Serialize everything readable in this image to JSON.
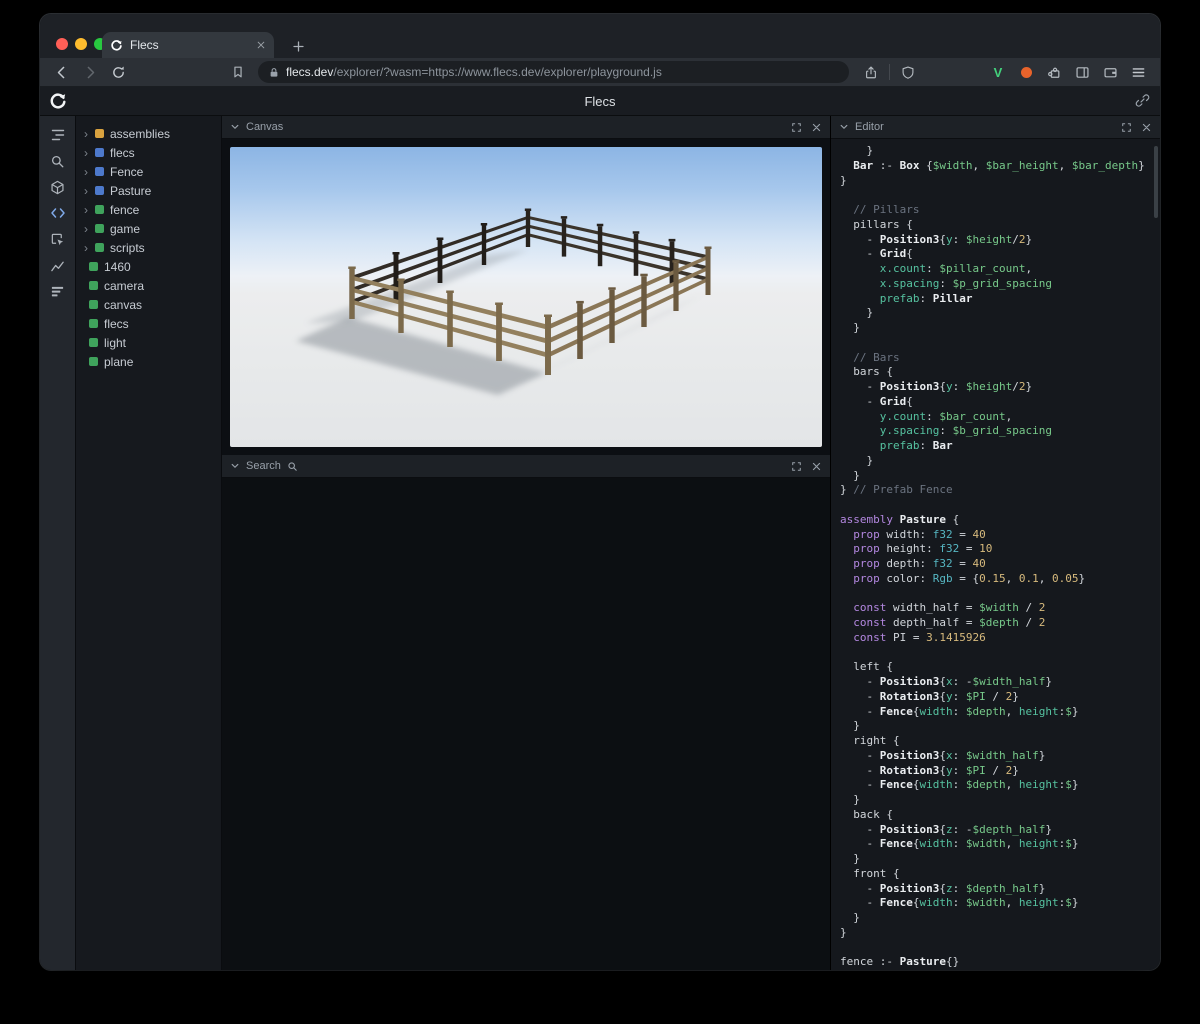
{
  "window": {
    "tab_title": "Flecs",
    "url_domain": "flecs.dev",
    "url_path": "/explorer/?wasm=https://www.flecs.dev/explorer/playground.js",
    "extension_v": "V"
  },
  "app": {
    "title": "Flecs"
  },
  "panels": {
    "canvas_title": "Canvas",
    "search_title": "Search",
    "editor_title": "Editor"
  },
  "activity_bar": {
    "icons": [
      "entity-tree-icon",
      "search-icon",
      "canvas-cube-icon",
      "code-icon",
      "inspect-icon",
      "stats-chart-icon",
      "queries-rows-icon"
    ]
  },
  "tree": {
    "items": [
      {
        "label": "assemblies",
        "color": "#d9a23f",
        "expandable": true
      },
      {
        "label": "flecs",
        "color": "#4d79cc",
        "expandable": true
      },
      {
        "label": "Fence",
        "color": "#4d79cc",
        "expandable": true
      },
      {
        "label": "Pasture",
        "color": "#4d79cc",
        "expandable": true
      },
      {
        "label": "fence",
        "color": "#3fa35c",
        "expandable": true
      },
      {
        "label": "game",
        "color": "#3fa35c",
        "expandable": true
      },
      {
        "label": "scripts",
        "color": "#3fa35c",
        "expandable": true
      },
      {
        "label": "1460",
        "color": "#3fa35c",
        "expandable": false
      },
      {
        "label": "camera",
        "color": "#3fa35c",
        "expandable": false
      },
      {
        "label": "canvas",
        "color": "#3fa35c",
        "expandable": false
      },
      {
        "label": "flecs",
        "color": "#3fa35c",
        "expandable": false
      },
      {
        "label": "light",
        "color": "#3fa35c",
        "expandable": false
      },
      {
        "label": "plane",
        "color": "#3fa35c",
        "expandable": false
      }
    ]
  },
  "editor": {
    "lines": [
      [
        [
          "p",
          "    }"
        ]
      ],
      [
        [
          "p",
          "  "
        ],
        [
          "b",
          "Bar"
        ],
        [
          "p",
          " :- "
        ],
        [
          "b",
          "Box"
        ],
        [
          "p",
          " {"
        ],
        [
          "v",
          "$width"
        ],
        [
          "p",
          ", "
        ],
        [
          "v",
          "$bar_height"
        ],
        [
          "p",
          ", "
        ],
        [
          "v",
          "$bar_depth"
        ],
        [
          "p",
          "}"
        ]
      ],
      [
        [
          "p",
          "}"
        ]
      ],
      [],
      [
        [
          "p",
          "  "
        ],
        [
          "c",
          "// Pillars"
        ]
      ],
      [
        [
          "p",
          "  pillars {"
        ]
      ],
      [
        [
          "p",
          "    - "
        ],
        [
          "b",
          "Position3"
        ],
        [
          "p",
          "{"
        ],
        [
          "m",
          "y"
        ],
        [
          "p",
          ": "
        ],
        [
          "v",
          "$height"
        ],
        [
          "p",
          "/"
        ],
        [
          "n",
          "2"
        ],
        [
          "p",
          "}"
        ]
      ],
      [
        [
          "p",
          "    - "
        ],
        [
          "b",
          "Grid"
        ],
        [
          "p",
          "{"
        ]
      ],
      [
        [
          "p",
          "      "
        ],
        [
          "m",
          "x.count"
        ],
        [
          "p",
          ": "
        ],
        [
          "v",
          "$pillar_count"
        ],
        [
          "p",
          ","
        ]
      ],
      [
        [
          "p",
          "      "
        ],
        [
          "m",
          "x.spacing"
        ],
        [
          "p",
          ": "
        ],
        [
          "v",
          "$p_grid_spacing"
        ]
      ],
      [
        [
          "p",
          "      "
        ],
        [
          "m",
          "prefab"
        ],
        [
          "p",
          ": "
        ],
        [
          "b",
          "Pillar"
        ]
      ],
      [
        [
          "p",
          "    }"
        ]
      ],
      [
        [
          "p",
          "  }"
        ]
      ],
      [],
      [
        [
          "p",
          "  "
        ],
        [
          "c",
          "// Bars"
        ]
      ],
      [
        [
          "p",
          "  bars {"
        ]
      ],
      [
        [
          "p",
          "    - "
        ],
        [
          "b",
          "Position3"
        ],
        [
          "p",
          "{"
        ],
        [
          "m",
          "y"
        ],
        [
          "p",
          ": "
        ],
        [
          "v",
          "$height"
        ],
        [
          "p",
          "/"
        ],
        [
          "n",
          "2"
        ],
        [
          "p",
          "}"
        ]
      ],
      [
        [
          "p",
          "    - "
        ],
        [
          "b",
          "Grid"
        ],
        [
          "p",
          "{"
        ]
      ],
      [
        [
          "p",
          "      "
        ],
        [
          "m",
          "y.count"
        ],
        [
          "p",
          ": "
        ],
        [
          "v",
          "$bar_count"
        ],
        [
          "p",
          ","
        ]
      ],
      [
        [
          "p",
          "      "
        ],
        [
          "m",
          "y.spacing"
        ],
        [
          "p",
          ": "
        ],
        [
          "v",
          "$b_grid_spacing"
        ]
      ],
      [
        [
          "p",
          "      "
        ],
        [
          "m",
          "prefab"
        ],
        [
          "p",
          ": "
        ],
        [
          "b",
          "Bar"
        ]
      ],
      [
        [
          "p",
          "    }"
        ]
      ],
      [
        [
          "p",
          "  }"
        ]
      ],
      [
        [
          "p",
          "} "
        ],
        [
          "c",
          "// Prefab Fence"
        ]
      ],
      [],
      [
        [
          "k",
          "assembly"
        ],
        [
          "p",
          " "
        ],
        [
          "b",
          "Pasture"
        ],
        [
          "p",
          " {"
        ]
      ],
      [
        [
          "p",
          "  "
        ],
        [
          "k",
          "prop"
        ],
        [
          "p",
          " width: "
        ],
        [
          "t",
          "f32"
        ],
        [
          "p",
          " = "
        ],
        [
          "n",
          "40"
        ]
      ],
      [
        [
          "p",
          "  "
        ],
        [
          "k",
          "prop"
        ],
        [
          "p",
          " height: "
        ],
        [
          "t",
          "f32"
        ],
        [
          "p",
          " = "
        ],
        [
          "n",
          "10"
        ]
      ],
      [
        [
          "p",
          "  "
        ],
        [
          "k",
          "prop"
        ],
        [
          "p",
          " depth: "
        ],
        [
          "t",
          "f32"
        ],
        [
          "p",
          " = "
        ],
        [
          "n",
          "40"
        ]
      ],
      [
        [
          "p",
          "  "
        ],
        [
          "k",
          "prop"
        ],
        [
          "p",
          " color: "
        ],
        [
          "t",
          "Rgb"
        ],
        [
          "p",
          " = {"
        ],
        [
          "n",
          "0.15"
        ],
        [
          "p",
          ", "
        ],
        [
          "n",
          "0.1"
        ],
        [
          "p",
          ", "
        ],
        [
          "n",
          "0.05"
        ],
        [
          "p",
          "}"
        ]
      ],
      [],
      [
        [
          "p",
          "  "
        ],
        [
          "k",
          "const"
        ],
        [
          "p",
          " width_half = "
        ],
        [
          "v",
          "$width"
        ],
        [
          "p",
          " / "
        ],
        [
          "n",
          "2"
        ]
      ],
      [
        [
          "p",
          "  "
        ],
        [
          "k",
          "const"
        ],
        [
          "p",
          " depth_half = "
        ],
        [
          "v",
          "$depth"
        ],
        [
          "p",
          " / "
        ],
        [
          "n",
          "2"
        ]
      ],
      [
        [
          "p",
          "  "
        ],
        [
          "k",
          "const"
        ],
        [
          "p",
          " PI = "
        ],
        [
          "n",
          "3.1415926"
        ]
      ],
      [],
      [
        [
          "p",
          "  left {"
        ]
      ],
      [
        [
          "p",
          "    - "
        ],
        [
          "b",
          "Position3"
        ],
        [
          "p",
          "{"
        ],
        [
          "m",
          "x"
        ],
        [
          "p",
          ": -"
        ],
        [
          "v",
          "$width_half"
        ],
        [
          "p",
          "}"
        ]
      ],
      [
        [
          "p",
          "    - "
        ],
        [
          "b",
          "Rotation3"
        ],
        [
          "p",
          "{"
        ],
        [
          "m",
          "y"
        ],
        [
          "p",
          ": "
        ],
        [
          "v",
          "$PI"
        ],
        [
          "p",
          " / "
        ],
        [
          "n",
          "2"
        ],
        [
          "p",
          "}"
        ]
      ],
      [
        [
          "p",
          "    - "
        ],
        [
          "b",
          "Fence"
        ],
        [
          "p",
          "{"
        ],
        [
          "m",
          "width"
        ],
        [
          "p",
          ": "
        ],
        [
          "v",
          "$depth"
        ],
        [
          "p",
          ", "
        ],
        [
          "m",
          "height"
        ],
        [
          "p",
          ":"
        ],
        [
          "v",
          "$"
        ],
        [
          "p",
          "}"
        ]
      ],
      [
        [
          "p",
          "  }"
        ]
      ],
      [
        [
          "p",
          "  right {"
        ]
      ],
      [
        [
          "p",
          "    - "
        ],
        [
          "b",
          "Position3"
        ],
        [
          "p",
          "{"
        ],
        [
          "m",
          "x"
        ],
        [
          "p",
          ": "
        ],
        [
          "v",
          "$width_half"
        ],
        [
          "p",
          "}"
        ]
      ],
      [
        [
          "p",
          "    - "
        ],
        [
          "b",
          "Rotation3"
        ],
        [
          "p",
          "{"
        ],
        [
          "m",
          "y"
        ],
        [
          "p",
          ": "
        ],
        [
          "v",
          "$PI"
        ],
        [
          "p",
          " / "
        ],
        [
          "n",
          "2"
        ],
        [
          "p",
          "}"
        ]
      ],
      [
        [
          "p",
          "    - "
        ],
        [
          "b",
          "Fence"
        ],
        [
          "p",
          "{"
        ],
        [
          "m",
          "width"
        ],
        [
          "p",
          ": "
        ],
        [
          "v",
          "$depth"
        ],
        [
          "p",
          ", "
        ],
        [
          "m",
          "height"
        ],
        [
          "p",
          ":"
        ],
        [
          "v",
          "$"
        ],
        [
          "p",
          "}"
        ]
      ],
      [
        [
          "p",
          "  }"
        ]
      ],
      [
        [
          "p",
          "  back {"
        ]
      ],
      [
        [
          "p",
          "    - "
        ],
        [
          "b",
          "Position3"
        ],
        [
          "p",
          "{"
        ],
        [
          "m",
          "z"
        ],
        [
          "p",
          ": -"
        ],
        [
          "v",
          "$depth_half"
        ],
        [
          "p",
          "}"
        ]
      ],
      [
        [
          "p",
          "    - "
        ],
        [
          "b",
          "Fence"
        ],
        [
          "p",
          "{"
        ],
        [
          "m",
          "width"
        ],
        [
          "p",
          ": "
        ],
        [
          "v",
          "$width"
        ],
        [
          "p",
          ", "
        ],
        [
          "m",
          "height"
        ],
        [
          "p",
          ":"
        ],
        [
          "v",
          "$"
        ],
        [
          "p",
          "}"
        ]
      ],
      [
        [
          "p",
          "  }"
        ]
      ],
      [
        [
          "p",
          "  front {"
        ]
      ],
      [
        [
          "p",
          "    - "
        ],
        [
          "b",
          "Position3"
        ],
        [
          "p",
          "{"
        ],
        [
          "m",
          "z"
        ],
        [
          "p",
          ": "
        ],
        [
          "v",
          "$depth_half"
        ],
        [
          "p",
          "}"
        ]
      ],
      [
        [
          "p",
          "    - "
        ],
        [
          "b",
          "Fence"
        ],
        [
          "p",
          "{"
        ],
        [
          "m",
          "width"
        ],
        [
          "p",
          ": "
        ],
        [
          "v",
          "$width"
        ],
        [
          "p",
          ", "
        ],
        [
          "m",
          "height"
        ],
        [
          "p",
          ":"
        ],
        [
          "v",
          "$"
        ],
        [
          "p",
          "}"
        ]
      ],
      [
        [
          "p",
          "  }"
        ]
      ],
      [
        [
          "p",
          "}"
        ]
      ],
      [],
      [
        [
          "p",
          "fence :- "
        ],
        [
          "b",
          "Pasture"
        ],
        [
          "p",
          "{}"
        ]
      ]
    ]
  }
}
